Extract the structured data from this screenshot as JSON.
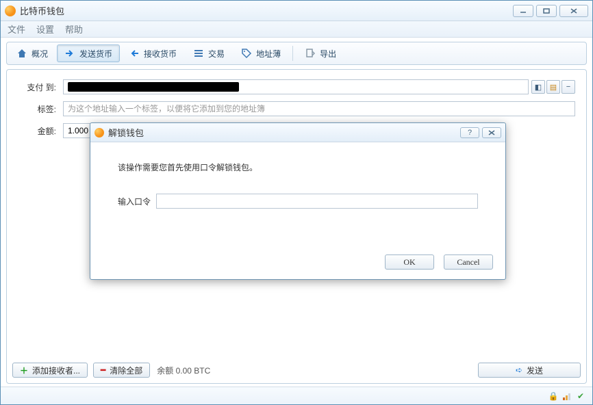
{
  "window": {
    "title": "比特币钱包"
  },
  "menu": {
    "file": "文件",
    "settings": "设置",
    "help": "帮助"
  },
  "toolbar": {
    "overview": "概况",
    "send": "发送货币",
    "receive": "接收货币",
    "transactions": "交易",
    "addressbook": "地址薄",
    "export": "导出"
  },
  "form": {
    "payto_label": "支付 到:",
    "payto_value": "████████████████████████████",
    "label_label": "标签:",
    "label_placeholder": "为这个地址输入一个标签，以便将它添加到您的地址簿",
    "amount_label": "金额:",
    "amount_value": "1.000"
  },
  "panel_bottom": {
    "add_recipient": "添加接收者...",
    "clear_all": "清除全部",
    "balance": "余额 0.00 BTC",
    "send": "发送"
  },
  "modal": {
    "title": "解锁钱包",
    "message": "该操作需要您首先使用口令解锁钱包。",
    "pw_label": "输入口令",
    "ok": "OK",
    "cancel": "Cancel"
  },
  "icons": {
    "bitcoin": "₿"
  }
}
